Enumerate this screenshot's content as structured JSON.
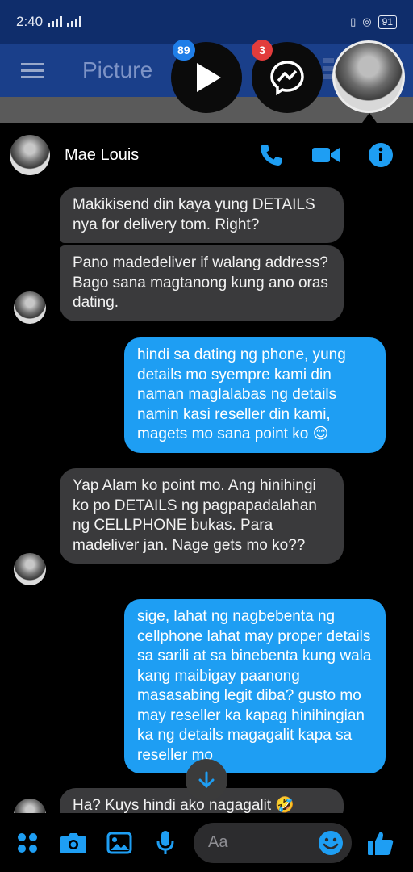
{
  "status_bar": {
    "time": "2:40",
    "battery": "91"
  },
  "app_bar": {
    "title": "Picture"
  },
  "chat_heads": [
    {
      "badge": "89",
      "icon": "play-icon",
      "badge_color": "#1f7ee8"
    },
    {
      "badge": "3",
      "icon": "messenger-icon",
      "badge_color": "#e23c3c"
    },
    {
      "icon": "avatar"
    }
  ],
  "conversation": {
    "contact_name": "Mae Louis",
    "messages": [
      {
        "from": "them",
        "text": "Makikisend din kaya yung DETAILS nya for delivery tom. Right?"
      },
      {
        "from": "them",
        "text": "Pano madedeliver if walang address? Bago sana magtanong kung ano oras dating."
      },
      {
        "from": "me",
        "text": "hindi sa dating ng phone, yung details mo syempre kami din naman maglalabas ng details namin kasi reseller din kami, magets mo sana point ko 😊"
      },
      {
        "from": "them",
        "text": "Yap Alam ko point mo. Ang hinihingi ko po DETAILS ng pagpapadalahan ng CELLPHONE bukas. Para madeliver jan. Nage gets mo ko??"
      },
      {
        "from": "me",
        "text": "sige, lahat ng nagbebenta ng cellphone lahat may proper details sa sarili at sa binebenta kung wala kang maibigay paanong masasabing legit diba? gusto mo may reseller ka kapag hinihingian ka ng details magagalit kapa sa reseller mo"
      },
      {
        "from": "them",
        "text": "Ha? Kuys hindi ako nagagalit 🤣"
      }
    ]
  },
  "composer": {
    "placeholder": "Aa"
  },
  "colors": {
    "accent": "#1e9ef3",
    "incoming": "#3a3a3c",
    "background": "#000000",
    "status_bar": "#0f2d6b"
  }
}
